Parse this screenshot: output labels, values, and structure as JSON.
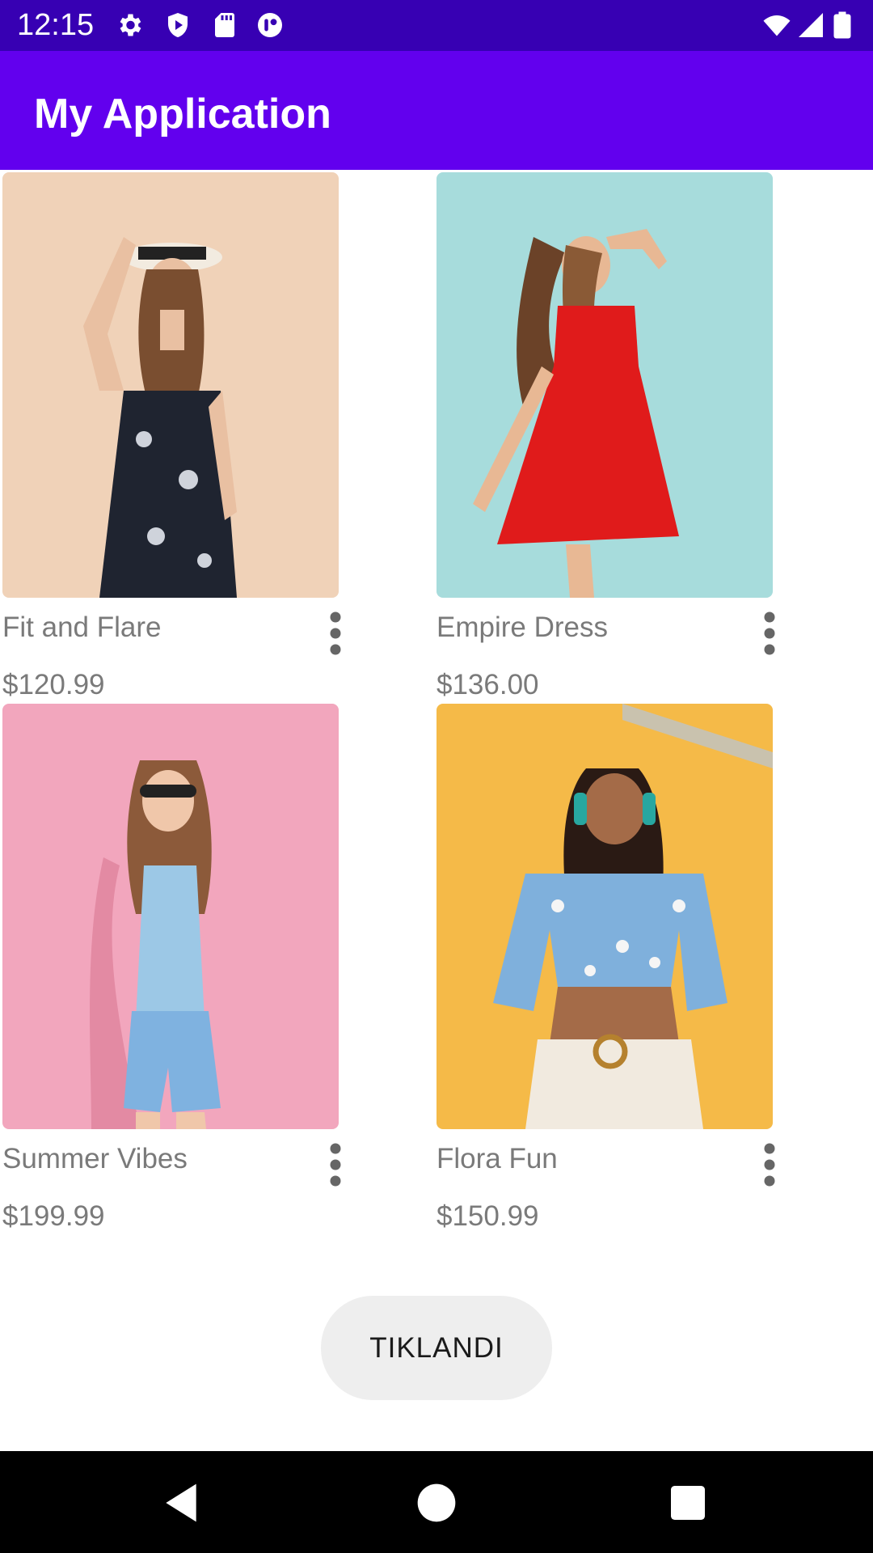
{
  "status_bar": {
    "time": "12:15",
    "icons": [
      "gear-icon",
      "shield-play-icon",
      "sd-card-icon",
      "app-badge-icon",
      "wifi-icon",
      "cellular-signal-icon",
      "battery-icon"
    ]
  },
  "app_bar": {
    "title": "My Application"
  },
  "products": [
    {
      "name": "Fit and Flare",
      "price": "$120.99",
      "photo_bg": "#f0d2b8",
      "accent": "#1f2430"
    },
    {
      "name": "Empire Dress",
      "price": "$136.00",
      "photo_bg": "#a7dcdc",
      "accent": "#e01b1b"
    },
    {
      "name": "Summer Vibes",
      "price": "$199.99",
      "photo_bg": "#f2a6bd",
      "accent": "#9cc8e6"
    },
    {
      "name": "Flora Fun",
      "price": "$150.99",
      "photo_bg": "#f5ba48",
      "accent": "#7fb0dc"
    }
  ],
  "button": {
    "label": "TIKLANDI"
  },
  "nav_bar": {
    "buttons": [
      "back-icon",
      "home-icon",
      "recents-icon"
    ]
  },
  "colors": {
    "status_bar": "#3700b3",
    "app_bar": "#6200ee",
    "text_secondary": "#7a7a7a",
    "button_bg": "#eeeeee"
  }
}
